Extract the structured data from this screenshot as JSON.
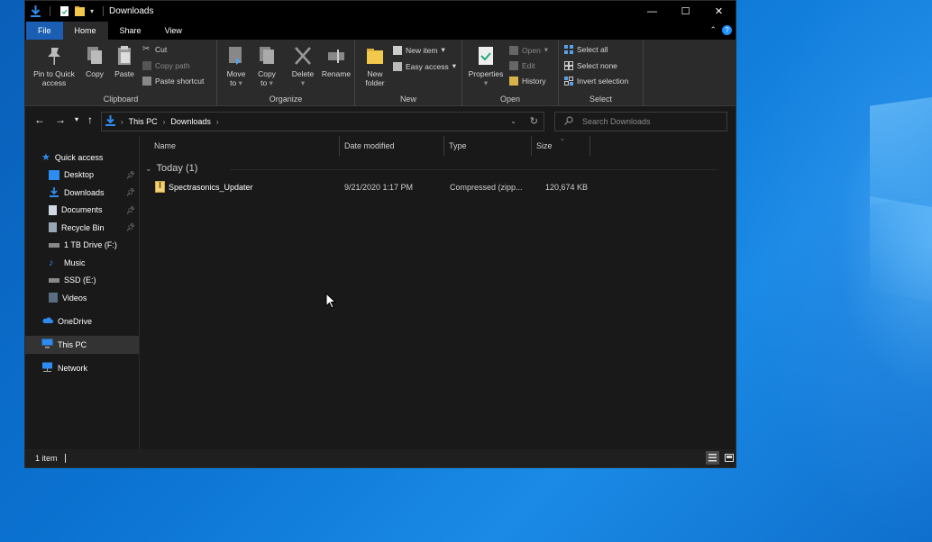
{
  "window": {
    "title": "Downloads",
    "controls": {
      "minimize": "—",
      "maximize": "☐",
      "close": "✕"
    }
  },
  "tabs": [
    {
      "label": "File"
    },
    {
      "label": "Home"
    },
    {
      "label": "Share"
    },
    {
      "label": "View"
    }
  ],
  "ribbon": {
    "clipboard": {
      "label": "Clipboard",
      "pin_line1": "Pin to Quick",
      "pin_line2": "access",
      "copy": "Copy",
      "paste": "Paste",
      "cut": "Cut",
      "copy_path": "Copy path",
      "paste_shortcut": "Paste shortcut"
    },
    "organize": {
      "label": "Organize",
      "move_to_line1": "Move",
      "move_to_line2": "to",
      "copy_to_line1": "Copy",
      "copy_to_line2": "to",
      "delete": "Delete",
      "rename": "Rename"
    },
    "new": {
      "label": "New",
      "new_folder_line1": "New",
      "new_folder_line2": "folder",
      "new_item": "New item",
      "easy_access": "Easy access"
    },
    "open": {
      "label": "Open",
      "properties": "Properties",
      "open": "Open",
      "edit": "Edit",
      "history": "History"
    },
    "select": {
      "label": "Select",
      "select_all": "Select all",
      "select_none": "Select none",
      "invert_selection": "Invert selection"
    }
  },
  "address": {
    "crumbs": [
      "This PC",
      "Downloads"
    ],
    "search_placeholder": "Search Downloads"
  },
  "nav": {
    "quick_access": "Quick access",
    "items": [
      {
        "label": "Desktop",
        "pinned": true
      },
      {
        "label": "Downloads",
        "pinned": true
      },
      {
        "label": "Documents",
        "pinned": true
      },
      {
        "label": "Recycle Bin",
        "pinned": true
      },
      {
        "label": "1 TB Drive (F:)",
        "pinned": false
      },
      {
        "label": "Music",
        "pinned": false
      },
      {
        "label": "SSD (E:)",
        "pinned": false
      },
      {
        "label": "Videos",
        "pinned": false
      }
    ],
    "onedrive": "OneDrive",
    "this_pc": "This PC",
    "network": "Network"
  },
  "columns": {
    "name": "Name",
    "date_modified": "Date modified",
    "type": "Type",
    "size": "Size"
  },
  "group": {
    "label": "Today (1)"
  },
  "files": [
    {
      "name": "Spectrasonics_Updater",
      "date_modified": "9/21/2020 1:17 PM",
      "type": "Compressed (zipp...",
      "size": "120,674 KB"
    }
  ],
  "status": {
    "item_count": "1 item"
  },
  "colors": {
    "window_bg": "#191919",
    "ribbon_bg": "#2b2b2b",
    "file_tab": "#1a5fb4",
    "accent_blue": "#1e90ff",
    "folder_yellow": "#f2c94c"
  }
}
